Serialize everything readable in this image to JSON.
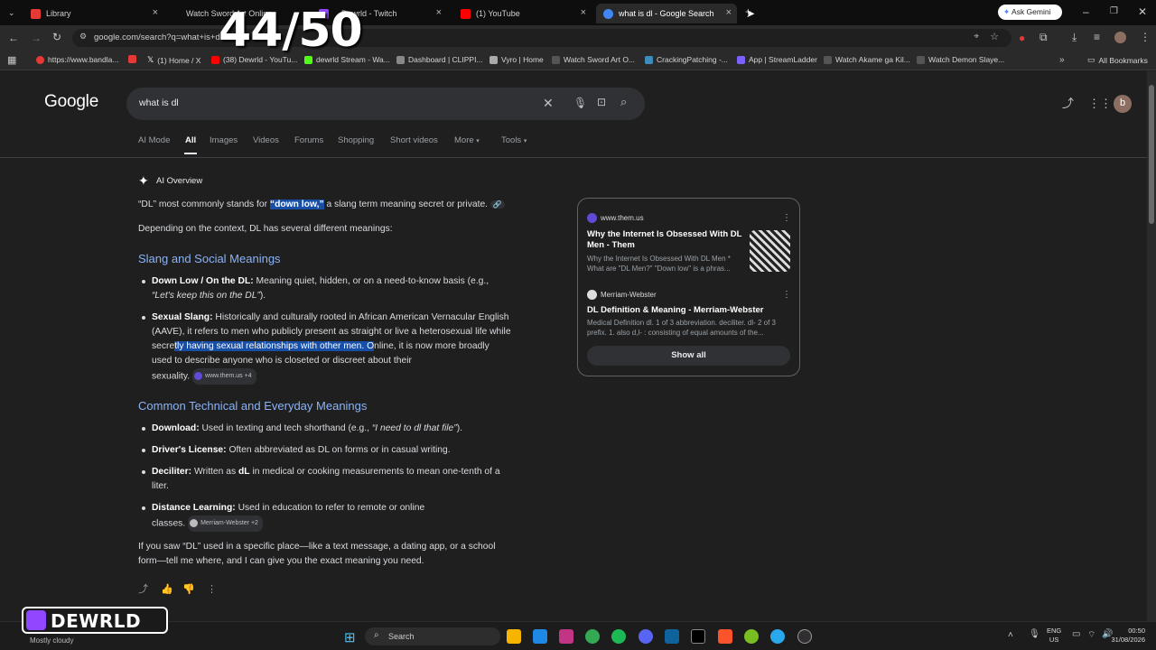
{
  "overlay": {
    "counter": "44/50",
    "brand": "DEWRLD"
  },
  "tabs": [
    {
      "label": "Library",
      "color": "#e53935"
    },
    {
      "label": "Watch Sword Art Online",
      "color": "#444444"
    },
    {
      "label": "Dewrld - Twitch",
      "color": "#9146ff"
    },
    {
      "label": "(1) YouTube",
      "color": "#ff0000"
    },
    {
      "label": "what is dl - Google Search",
      "color": "#4285f4"
    }
  ],
  "gemini_button": "Ask Gemini",
  "address_bar": {
    "url": "google.com/search?q=what+is+dl"
  },
  "bookmarks": [
    {
      "label": "https://www.bandla...",
      "color": "#e53935"
    },
    {
      "label": "(1) Home / X",
      "color": "#ffffff"
    },
    {
      "label": "(38) Dewrld - YouTu...",
      "color": "#ff0000"
    },
    {
      "label": "dewrld Stream - Wa...",
      "color": "#53fc18"
    },
    {
      "label": "Dashboard | CLIPPI...",
      "color": "#888888"
    },
    {
      "label": "Vyro | Home",
      "color": "#aaaaaa"
    },
    {
      "label": "Watch Sword Art O...",
      "color": "#555555"
    },
    {
      "label": "CrackingPatching -...",
      "color": "#3c8dbc"
    },
    {
      "label": "App | StreamLadder",
      "color": "#7b61ff"
    },
    {
      "label": "Watch Akame ga Kil...",
      "color": "#555555"
    },
    {
      "label": "Watch Demon Slaye...",
      "color": "#555555"
    }
  ],
  "all_bookmarks": "All Bookmarks",
  "google": {
    "logo": "Google",
    "query": "what is dl",
    "avatar": "b",
    "nav": [
      "AI Mode",
      "All",
      "Images",
      "Videos",
      "Forums",
      "Shopping",
      "Short videos",
      "More",
      "Tools"
    ]
  },
  "ai_overview": {
    "label": "AI Overview",
    "intro_pre": "“DL” most commonly stands for ",
    "intro_hl": "“down low,”",
    "intro_post": " a slang term meaning secret or private.",
    "context": "Depending on the context, DL has several different meanings:",
    "h_slang": "Slang and Social Meanings",
    "b1_term": "Down Low / On the DL:",
    "b1_text": " Meaning quiet, hidden, or on a need-to-know basis (e.g.,",
    "b1_example": "“Let's keep this on the DL”",
    "b1_end": ").",
    "b2_term": "Sexual Slang:",
    "b2_l1": " Historically and culturally rooted in African American Vernacular English",
    "b2_l2": "(AAVE), it refers to men who publicly present as straight or live a heterosexual life while",
    "b2_l3a": "secre",
    "b2_l3hl": "tly having sexual relationships with other men. O",
    "b2_l3b": "nline, it is now more broadly",
    "b2_l4": "used to describe anyone who is closeted or discreet about their",
    "b2_l5": "sexuality.",
    "b2_chip": "www.them.us +4",
    "h_tech": "Common Technical and Everyday Meanings",
    "t1_term": "Download:",
    "t1_text": " Used in texting and tech shorthand (e.g.,",
    "t1_example": "“I need to dl that file”",
    "t1_end": ").",
    "t2_term": "Driver's License:",
    "t2_text": " Often abbreviated as DL on forms or in casual writing.",
    "t3_term": "Deciliter:",
    "t3_text": " Written as",
    "t3_dl": "dL",
    "t3_text2": " in medical or cooking measurements to mean one-tenth of a",
    "t3_l2": "liter.",
    "t4_term": "Distance Learning:",
    "t4_text": " Used in education to refer to remote or online",
    "t4_l2": "classes.",
    "t4_chip": "Merriam-Webster +2",
    "closing_l1": "If you saw “DL” used in a specific place—like a text message, a dating app, or a school",
    "closing_l2": "form—tell me where, and I can give you the exact meaning you need."
  },
  "sources": [
    {
      "site": "www.them.us",
      "title": "Why the Internet Is Obsessed With DL Men - Them",
      "desc": "Why the Internet Is Obsessed With DL Men * What are \"DL Men?\" \"Down low\" is a phras..."
    },
    {
      "site": "Merriam-Webster",
      "title": "DL Definition & Meaning - Merriam-Webster",
      "desc": "Medical Definition dl. 1 of 3 abbreviation. deciliter. dl- 2 of 3 prefix. 1. also d,l- : consisting of equal amounts of the..."
    }
  ],
  "show_all": "Show all",
  "taskbar": {
    "search": "Search",
    "weather": "Mostly cloudy",
    "lang1": "ENG",
    "lang2": "US",
    "time": "00:50",
    "date": "31/08/2026"
  }
}
